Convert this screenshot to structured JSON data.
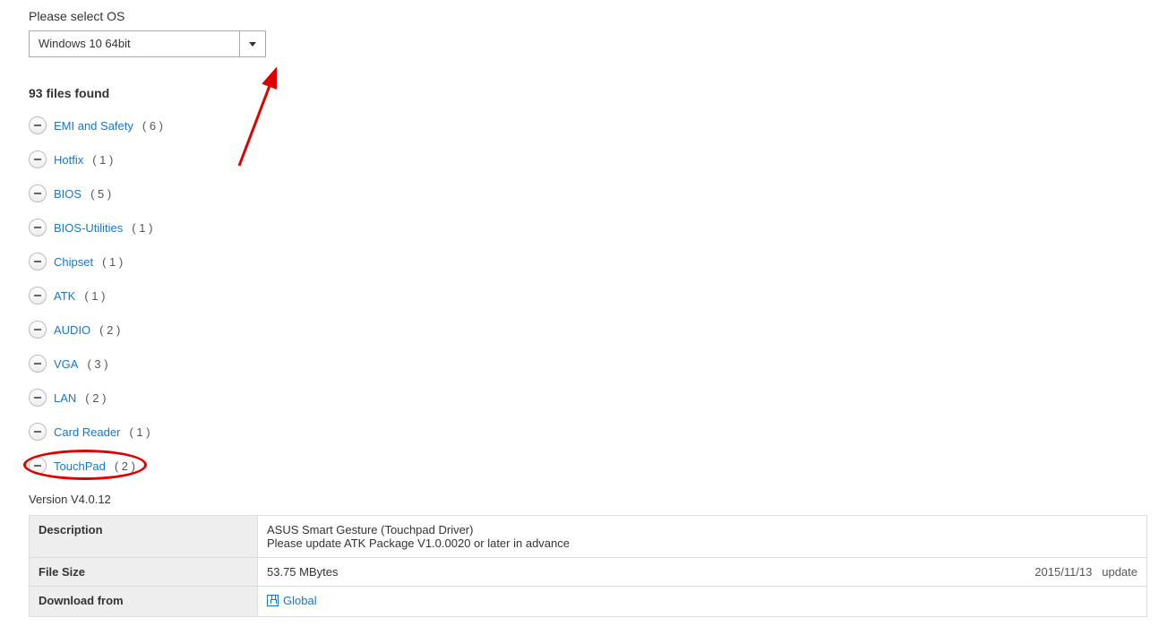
{
  "selectLabel": "Please select OS",
  "selectedOS": "Windows 10 64bit",
  "filesFound": "93 files found",
  "categories": [
    {
      "name": "EMI and Safety",
      "count": "( 6 )"
    },
    {
      "name": "Hotfix",
      "count": "( 1 )"
    },
    {
      "name": "BIOS",
      "count": "( 5 )"
    },
    {
      "name": "BIOS-Utilities",
      "count": "( 1 )"
    },
    {
      "name": "Chipset",
      "count": "( 1 )"
    },
    {
      "name": "ATK",
      "count": "( 1 )"
    },
    {
      "name": "AUDIO",
      "count": "( 2 )"
    },
    {
      "name": "VGA",
      "count": "( 3 )"
    },
    {
      "name": "LAN",
      "count": "( 2 )"
    },
    {
      "name": "Card Reader",
      "count": "( 1 )"
    },
    {
      "name": "TouchPad",
      "count": "( 2 )"
    }
  ],
  "highlightedIndex": 10,
  "versionText": "Version V4.0.12",
  "table": {
    "descriptionLabel": "Description",
    "descriptionLine1": "ASUS Smart Gesture (Touchpad Driver)",
    "descriptionLine2": "Please update ATK Package V1.0.0020 or later in advance",
    "fileSizeLabel": "File Size",
    "fileSizeValue": "53.75 MBytes",
    "updateDate": "2015/11/13",
    "updateText": "update",
    "downloadFromLabel": "Download from",
    "downloadLink": "Global"
  }
}
